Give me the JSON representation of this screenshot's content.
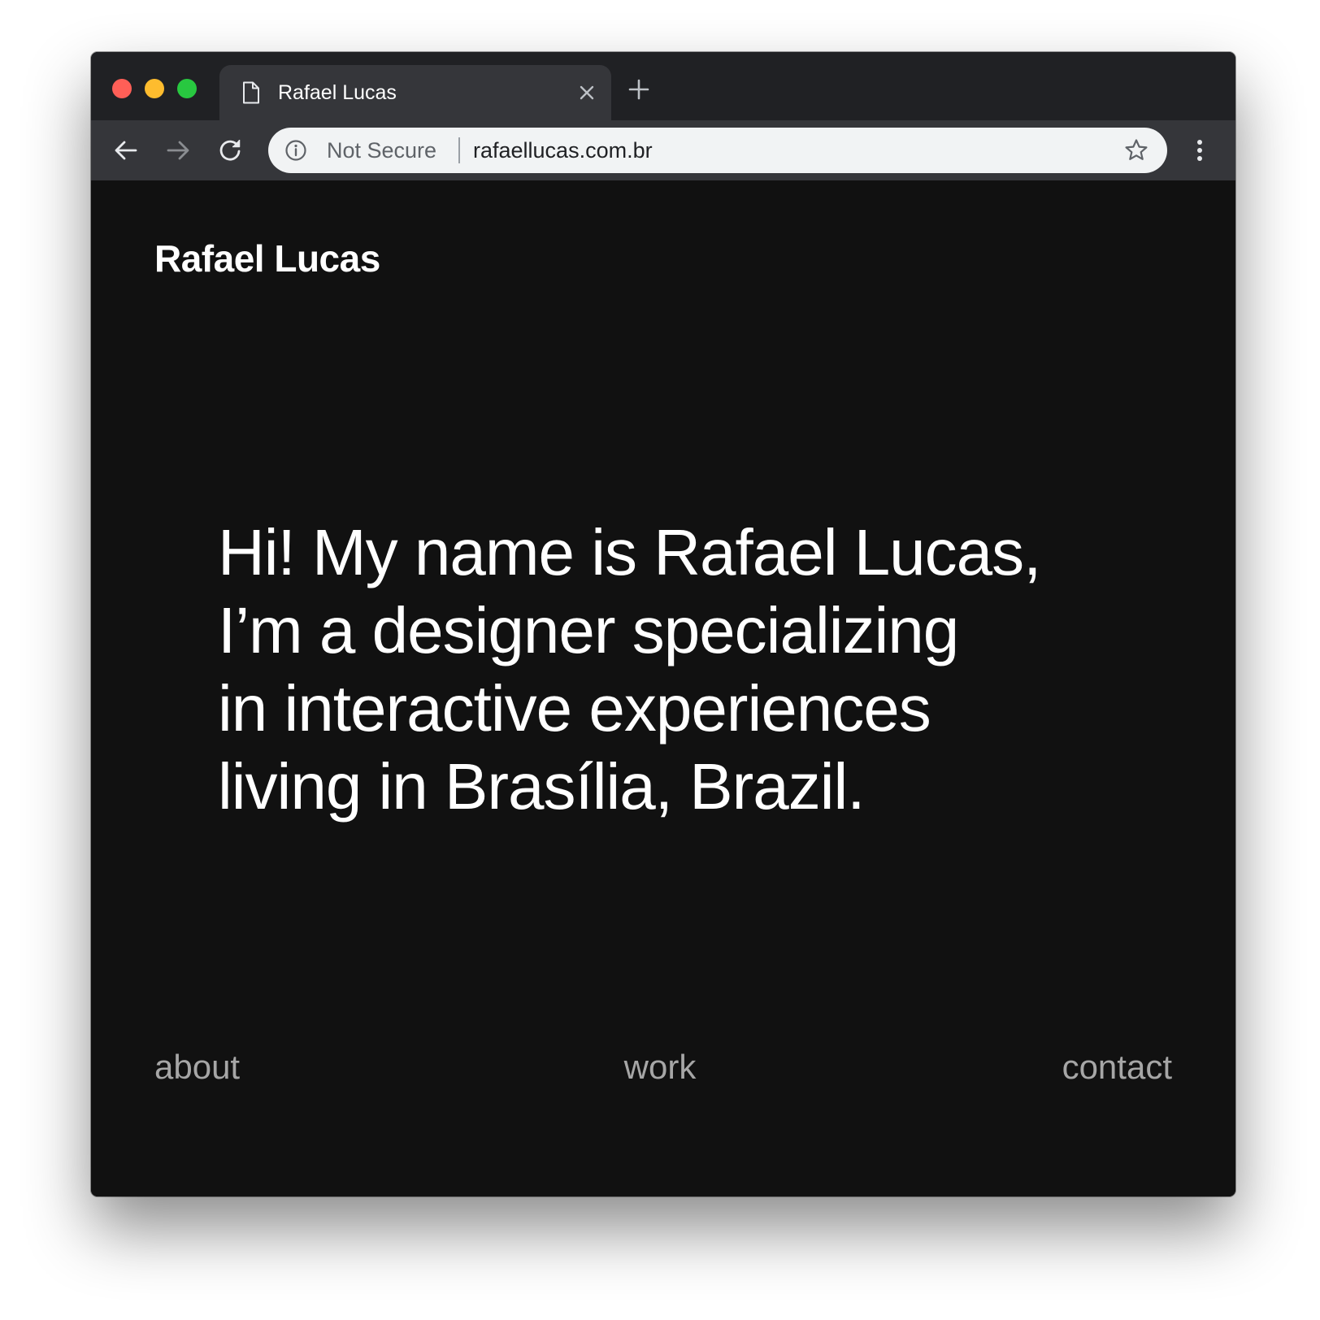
{
  "browser": {
    "tab": {
      "title": "Rafael Lucas",
      "icon": "page-icon",
      "close_icon": "close-icon"
    },
    "new_tab_icon": "plus-icon",
    "toolbar": {
      "back_icon": "arrow-left-icon",
      "forward_icon": "arrow-right-icon",
      "reload_icon": "reload-icon",
      "security_label": "Not Secure",
      "url": "rafaellucas.com.br",
      "bookmark_icon": "star-icon",
      "menu_icon": "kebab-menu-icon"
    },
    "colors": {
      "tabbar": "#202124",
      "tab_active": "#35363a",
      "omnibox": "#f1f3f4",
      "close": "#ff5f57",
      "minimize": "#febc2e",
      "maximize": "#28c840"
    }
  },
  "page": {
    "logo": "Rafael Lucas",
    "intro_lines": [
      "Hi! My name is Rafael Lucas,",
      "I’m a designer specializing",
      "in interactive experiences",
      "living in Brasília, Brazil."
    ],
    "nav": {
      "about": "about",
      "work": "work",
      "contact": "contact"
    },
    "colors": {
      "background": "#111111",
      "text": "#ffffff",
      "nav_text": "#a6a6a6"
    }
  }
}
